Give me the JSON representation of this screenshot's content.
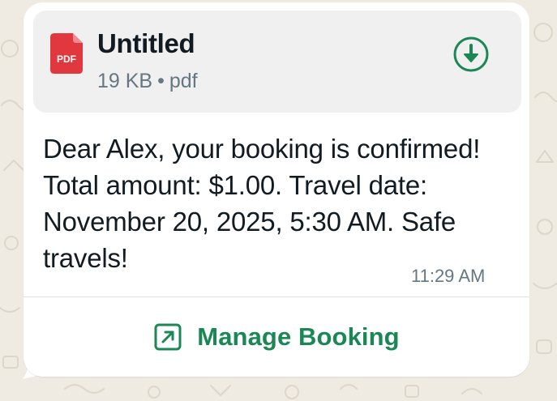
{
  "attachment": {
    "file_name": "Untitled",
    "file_size": "19 KB",
    "file_type": "pdf",
    "icon_label": "PDF",
    "icon": "pdf-file-icon",
    "download_icon": "download-icon"
  },
  "message": {
    "text": "Dear Alex, your booking is confirmed! Total amount: $1.00. Travel date: November 20, 2025, 5:30 AM. Safe travels!",
    "time": "11:29 AM"
  },
  "action": {
    "label": "Manage Booking",
    "icon": "external-link-icon"
  },
  "colors": {
    "background": "#efeae2",
    "bubble": "#ffffff",
    "attachment_bg": "#f0f0f0",
    "accent_green": "#1b8755",
    "pdf_red": "#e0383e",
    "text_primary": "#111b21",
    "text_secondary": "#667781"
  }
}
